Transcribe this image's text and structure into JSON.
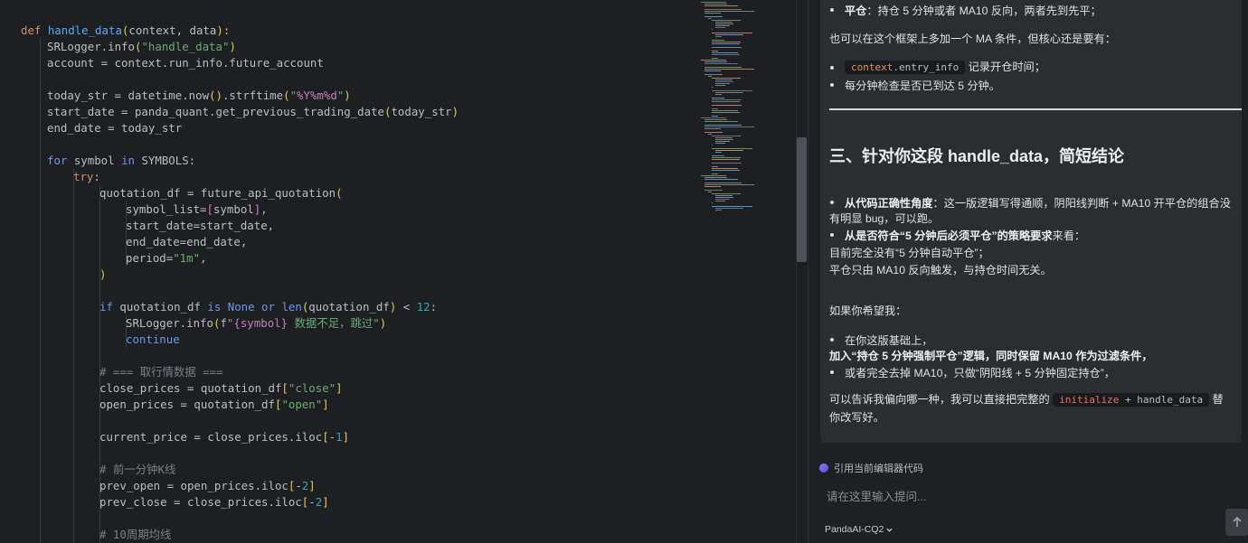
{
  "editor": {
    "lines": [
      {
        "indent": 0,
        "tokens": [
          [
            "kw",
            "def "
          ],
          [
            "fn",
            "handle_data"
          ],
          [
            "bracket",
            "("
          ],
          [
            "plain",
            "context, data"
          ],
          [
            "bracket",
            "):"
          ]
        ]
      },
      {
        "indent": 1,
        "tokens": [
          [
            "plain",
            "SRLogger.info"
          ],
          [
            "bracket",
            "("
          ],
          [
            "str",
            "\"handle_data\""
          ],
          [
            "bracket",
            ")"
          ]
        ]
      },
      {
        "indent": 1,
        "tokens": [
          [
            "plain",
            "account = context.run_info.future_account"
          ]
        ]
      },
      {
        "indent": 1,
        "tokens": []
      },
      {
        "indent": 1,
        "tokens": [
          [
            "plain",
            "today_str = datetime.now"
          ],
          [
            "bracket",
            "()"
          ],
          [
            "plain",
            ".strftime"
          ],
          [
            "bracket",
            "("
          ],
          [
            "str",
            "\""
          ],
          [
            "strc",
            "%Y%m%d"
          ],
          [
            "str",
            "\""
          ],
          [
            "bracket",
            ")"
          ]
        ]
      },
      {
        "indent": 1,
        "tokens": [
          [
            "plain",
            "start_date = panda_quant.get_previous_trading_date"
          ],
          [
            "bracket",
            "("
          ],
          [
            "plain",
            "today_str"
          ],
          [
            "bracket",
            ")"
          ]
        ]
      },
      {
        "indent": 1,
        "tokens": [
          [
            "plain",
            "end_date = today_str"
          ]
        ]
      },
      {
        "indent": 1,
        "tokens": []
      },
      {
        "indent": 1,
        "tokens": [
          [
            "kwb",
            "for "
          ],
          [
            "plain",
            "symbol "
          ],
          [
            "kwb",
            "in "
          ],
          [
            "plain",
            "SYMBOLS:"
          ]
        ]
      },
      {
        "indent": 2,
        "tokens": [
          [
            "kw",
            "try"
          ],
          [
            "plain",
            ":"
          ]
        ]
      },
      {
        "indent": 3,
        "tokens": [
          [
            "plain",
            "quotation_df = future_api_quotation"
          ],
          [
            "bracket",
            "("
          ]
        ]
      },
      {
        "indent": 4,
        "tokens": [
          [
            "plain",
            "symbol_list="
          ],
          [
            "pur",
            "["
          ],
          [
            "plain",
            "symbol"
          ],
          [
            "pur",
            "]"
          ],
          [
            "plain",
            ","
          ]
        ]
      },
      {
        "indent": 4,
        "tokens": [
          [
            "plain",
            "start_date=start_date,"
          ]
        ]
      },
      {
        "indent": 4,
        "tokens": [
          [
            "plain",
            "end_date=end_date,"
          ]
        ]
      },
      {
        "indent": 4,
        "tokens": [
          [
            "plain",
            "period="
          ],
          [
            "str",
            "\"1m\""
          ],
          [
            "plain",
            ","
          ]
        ]
      },
      {
        "indent": 3,
        "tokens": [
          [
            "bracket",
            ")"
          ]
        ]
      },
      {
        "indent": 3,
        "tokens": []
      },
      {
        "indent": 3,
        "tokens": [
          [
            "kwb",
            "if "
          ],
          [
            "plain",
            "quotation_df "
          ],
          [
            "kwb",
            "is None or "
          ],
          [
            "kwb",
            "len"
          ],
          [
            "bracket",
            "("
          ],
          [
            "plain",
            "quotation_df"
          ],
          [
            "bracket",
            ")"
          ],
          [
            "plain",
            " < "
          ],
          [
            "num",
            "12"
          ],
          [
            "plain",
            ":"
          ]
        ]
      },
      {
        "indent": 4,
        "tokens": [
          [
            "plain",
            "SRLogger.info"
          ],
          [
            "bracket",
            "("
          ],
          [
            "plain",
            "f"
          ],
          [
            "str",
            "\""
          ],
          [
            "strc",
            "{symbol}"
          ],
          [
            "str",
            " 数据不足，跳过\""
          ],
          [
            "bracket",
            ")"
          ]
        ]
      },
      {
        "indent": 4,
        "tokens": [
          [
            "kwb",
            "continue"
          ]
        ]
      },
      {
        "indent": 3,
        "tokens": []
      },
      {
        "indent": 3,
        "tokens": [
          [
            "cmt",
            "# === 取行情数据 ==="
          ]
        ]
      },
      {
        "indent": 3,
        "tokens": [
          [
            "plain",
            "close_prices = quotation_df"
          ],
          [
            "bracket",
            "["
          ],
          [
            "str",
            "\"close\""
          ],
          [
            "bracket",
            "]"
          ]
        ]
      },
      {
        "indent": 3,
        "tokens": [
          [
            "plain",
            "open_prices = quotation_df"
          ],
          [
            "bracket",
            "["
          ],
          [
            "str",
            "\"open\""
          ],
          [
            "bracket",
            "]"
          ]
        ]
      },
      {
        "indent": 3,
        "tokens": []
      },
      {
        "indent": 3,
        "tokens": [
          [
            "plain",
            "current_price = close_prices.iloc"
          ],
          [
            "bracket",
            "["
          ],
          [
            "plain",
            "-"
          ],
          [
            "num",
            "1"
          ],
          [
            "bracket",
            "]"
          ]
        ]
      },
      {
        "indent": 3,
        "tokens": []
      },
      {
        "indent": 3,
        "tokens": [
          [
            "cmt",
            "# 前一分钟K线"
          ]
        ]
      },
      {
        "indent": 3,
        "tokens": [
          [
            "plain",
            "prev_open = open_prices.iloc"
          ],
          [
            "bracket",
            "["
          ],
          [
            "plain",
            "-"
          ],
          [
            "num",
            "2"
          ],
          [
            "bracket",
            "]"
          ]
        ]
      },
      {
        "indent": 3,
        "tokens": [
          [
            "plain",
            "prev_close = close_prices.iloc"
          ],
          [
            "bracket",
            "["
          ],
          [
            "plain",
            "-"
          ],
          [
            "num",
            "2"
          ],
          [
            "bracket",
            "]"
          ]
        ]
      },
      {
        "indent": 3,
        "tokens": []
      },
      {
        "indent": 3,
        "tokens": [
          [
            "cmt",
            "# 10周期均线"
          ]
        ]
      }
    ]
  },
  "chat": {
    "b1_bold": "平仓",
    "b1_rest": "：持仓 5 分钟或者 MA10 反向，两者先到先平；",
    "p1": "也可以在这个框架上多加一个 MA 条件，但核心还是要有：",
    "b2_code_a": "context",
    "b2_code_b": ".entry_info",
    "b2_rest": " 记录开仓时间；",
    "b3": "每分钟检查是否已到达 5 分钟。",
    "heading": "三、针对你这段 handle_data，简短结论",
    "b4_bold": "从代码正确性角度",
    "b4_rest1": "：这一版逻辑写得通顺，阴阳线判断 + MA10 开平仓的组合没",
    "b4_rest2": "有明显 bug，可以跑。",
    "b5_bold": "从是否符合“5 分钟后必须平仓”的策略要求",
    "b5_rest": "来看：",
    "p2": "目前完全没有“5 分钟自动平仓”；",
    "p3": "平仓只由 MA10 反向触发，与持仓时间无关。",
    "p4": "如果你希望我：",
    "b6": "在你这版基础上，",
    "p5": "加入“持仓 5 分钟强制平仓”逻辑，同时保留 MA10 作为过滤条件，",
    "b7": "或者完全去掉 MA10，只做“阴阳线 + 5 分钟固定持仓”，",
    "p6_a": "可以告诉我偏向哪一种，我可以直接把完整的",
    "p6_code_a": "initialize",
    "p6_code_b": " + handle_data",
    "p6_b": "替",
    "p6_c": "你改写好。"
  },
  "footer": {
    "ref_label": "引用当前编辑器代码",
    "input_placeholder": "请在这里输入提问...",
    "model_name": "PandaAI-CQ2"
  }
}
